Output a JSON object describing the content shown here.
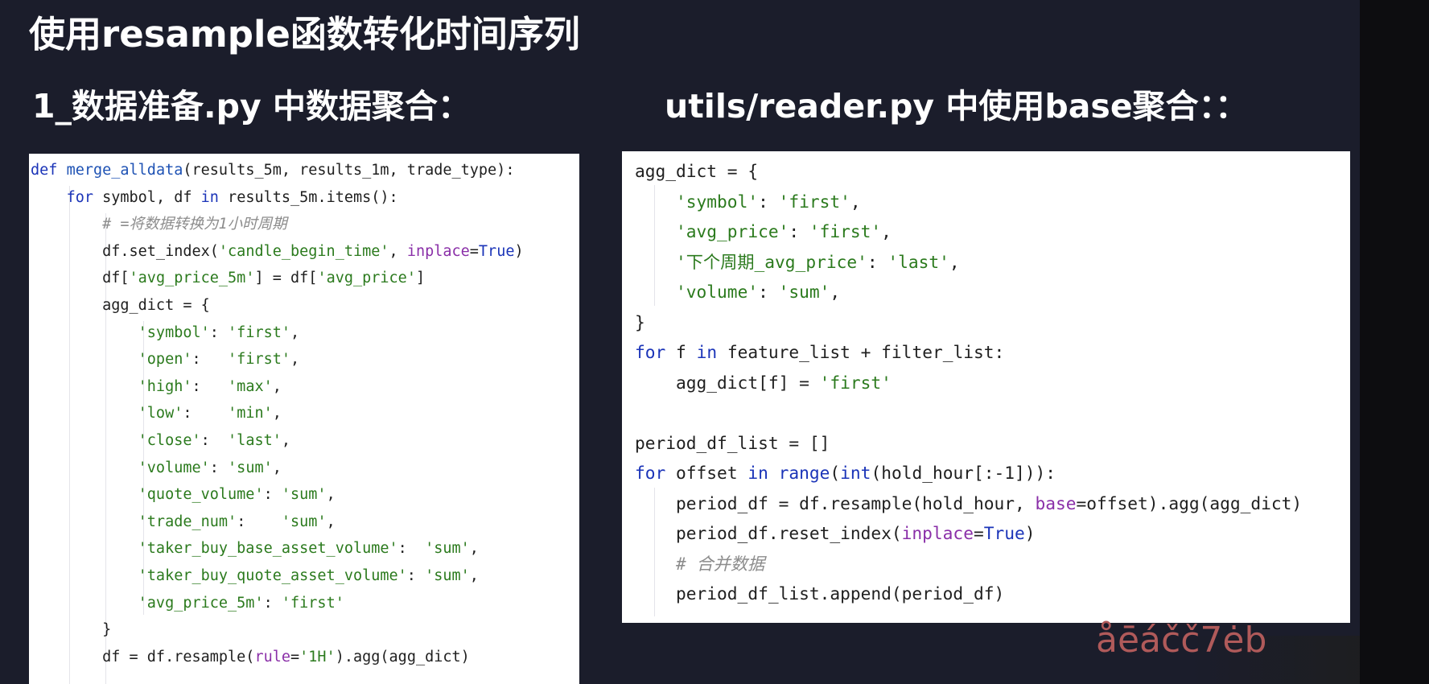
{
  "slide": {
    "title": "使用resample函数转化时间序列",
    "heading_left": "1_数据准备.py 中数据聚合：",
    "heading_right": "utils/reader.py 中使用base聚合：："
  },
  "watermark": "åēáčč7ėb",
  "code_left": [
    [
      [
        "kw",
        "def "
      ],
      [
        "fn",
        "merge_alldata"
      ],
      [
        "plain",
        "(results_5m, results_1m, trade_type):"
      ]
    ],
    [
      [
        "plain",
        "    "
      ],
      [
        "kw",
        "for"
      ],
      [
        "plain",
        " symbol, df "
      ],
      [
        "kw",
        "in"
      ],
      [
        "plain",
        " results_5m.items():"
      ]
    ],
    [
      [
        "plain",
        "        "
      ],
      [
        "cmt",
        "# =将数据转换为1小时周期"
      ]
    ],
    [
      [
        "plain",
        "        df.set_index("
      ],
      [
        "str",
        "'candle_begin_time'"
      ],
      [
        "plain",
        ", "
      ],
      [
        "param",
        "inplace"
      ],
      [
        "plain",
        "="
      ],
      [
        "const",
        "True"
      ],
      [
        "plain",
        ")"
      ]
    ],
    [
      [
        "plain",
        "        df["
      ],
      [
        "str",
        "'avg_price_5m'"
      ],
      [
        "plain",
        "] = df["
      ],
      [
        "str",
        "'avg_price'"
      ],
      [
        "plain",
        "]"
      ]
    ],
    [
      [
        "plain",
        "        agg_dict = {"
      ]
    ],
    [
      [
        "plain",
        "            "
      ],
      [
        "str",
        "'symbol'"
      ],
      [
        "plain",
        ": "
      ],
      [
        "str",
        "'first'"
      ],
      [
        "plain",
        ","
      ]
    ],
    [
      [
        "plain",
        "            "
      ],
      [
        "str",
        "'open'"
      ],
      [
        "plain",
        ":   "
      ],
      [
        "str",
        "'first'"
      ],
      [
        "plain",
        ","
      ]
    ],
    [
      [
        "plain",
        "            "
      ],
      [
        "str",
        "'high'"
      ],
      [
        "plain",
        ":   "
      ],
      [
        "str",
        "'max'"
      ],
      [
        "plain",
        ","
      ]
    ],
    [
      [
        "plain",
        "            "
      ],
      [
        "str",
        "'low'"
      ],
      [
        "plain",
        ":    "
      ],
      [
        "str",
        "'min'"
      ],
      [
        "plain",
        ","
      ]
    ],
    [
      [
        "plain",
        "            "
      ],
      [
        "str",
        "'close'"
      ],
      [
        "plain",
        ":  "
      ],
      [
        "str",
        "'last'"
      ],
      [
        "plain",
        ","
      ]
    ],
    [
      [
        "plain",
        "            "
      ],
      [
        "str",
        "'volume'"
      ],
      [
        "plain",
        ": "
      ],
      [
        "str",
        "'sum'"
      ],
      [
        "plain",
        ","
      ]
    ],
    [
      [
        "plain",
        "            "
      ],
      [
        "str",
        "'quote_volume'"
      ],
      [
        "plain",
        ": "
      ],
      [
        "str",
        "'sum'"
      ],
      [
        "plain",
        ","
      ]
    ],
    [
      [
        "plain",
        "            "
      ],
      [
        "str",
        "'trade_num'"
      ],
      [
        "plain",
        ":    "
      ],
      [
        "str",
        "'sum'"
      ],
      [
        "plain",
        ","
      ]
    ],
    [
      [
        "plain",
        "            "
      ],
      [
        "str",
        "'taker_buy_base_asset_volume'"
      ],
      [
        "plain",
        ":  "
      ],
      [
        "str",
        "'sum'"
      ],
      [
        "plain",
        ","
      ]
    ],
    [
      [
        "plain",
        "            "
      ],
      [
        "str",
        "'taker_buy_quote_asset_volume'"
      ],
      [
        "plain",
        ": "
      ],
      [
        "str",
        "'sum'"
      ],
      [
        "plain",
        ","
      ]
    ],
    [
      [
        "plain",
        "            "
      ],
      [
        "str",
        "'avg_price_5m'"
      ],
      [
        "plain",
        ": "
      ],
      [
        "str",
        "'first'"
      ]
    ],
    [
      [
        "plain",
        "        }"
      ]
    ],
    [
      [
        "plain",
        "        df = df.resample("
      ],
      [
        "param",
        "rule"
      ],
      [
        "plain",
        "="
      ],
      [
        "str",
        "'1H'"
      ],
      [
        "plain",
        ").agg(agg_dict)"
      ]
    ]
  ],
  "code_right": [
    [
      [
        "plain",
        "agg_dict = {"
      ]
    ],
    [
      [
        "plain",
        "    "
      ],
      [
        "str",
        "'symbol'"
      ],
      [
        "plain",
        ": "
      ],
      [
        "str",
        "'first'"
      ],
      [
        "plain",
        ","
      ]
    ],
    [
      [
        "plain",
        "    "
      ],
      [
        "str",
        "'avg_price'"
      ],
      [
        "plain",
        ": "
      ],
      [
        "str",
        "'first'"
      ],
      [
        "plain",
        ","
      ]
    ],
    [
      [
        "plain",
        "    "
      ],
      [
        "str",
        "'下个周期_avg_price'"
      ],
      [
        "plain",
        ": "
      ],
      [
        "str",
        "'last'"
      ],
      [
        "plain",
        ","
      ]
    ],
    [
      [
        "plain",
        "    "
      ],
      [
        "str",
        "'volume'"
      ],
      [
        "plain",
        ": "
      ],
      [
        "str",
        "'sum'"
      ],
      [
        "plain",
        ","
      ]
    ],
    [
      [
        "plain",
        "}"
      ]
    ],
    [
      [
        "kw",
        "for"
      ],
      [
        "plain",
        " f "
      ],
      [
        "kw",
        "in"
      ],
      [
        "plain",
        " feature_list + filter_list:"
      ]
    ],
    [
      [
        "plain",
        "    agg_dict[f] = "
      ],
      [
        "str",
        "'first'"
      ]
    ],
    [
      [
        "plain",
        ""
      ]
    ],
    [
      [
        "plain",
        "period_df_list = []"
      ]
    ],
    [
      [
        "kw",
        "for"
      ],
      [
        "plain",
        " offset "
      ],
      [
        "kw",
        "in"
      ],
      [
        "plain",
        " "
      ],
      [
        "kw",
        "range"
      ],
      [
        "plain",
        "("
      ],
      [
        "kw",
        "int"
      ],
      [
        "plain",
        "(hold_hour[:-1])):"
      ]
    ],
    [
      [
        "plain",
        "    period_df = df.resample(hold_hour, "
      ],
      [
        "param",
        "base"
      ],
      [
        "plain",
        "=offset).agg(agg_dict)"
      ]
    ],
    [
      [
        "plain",
        "    period_df.reset_index("
      ],
      [
        "param",
        "inplace"
      ],
      [
        "plain",
        "="
      ],
      [
        "const",
        "True"
      ],
      [
        "plain",
        ")"
      ]
    ],
    [
      [
        "plain",
        "    "
      ],
      [
        "cmt",
        "# 合并数据"
      ]
    ],
    [
      [
        "plain",
        "    period_df_list.append(period_df)"
      ]
    ]
  ]
}
